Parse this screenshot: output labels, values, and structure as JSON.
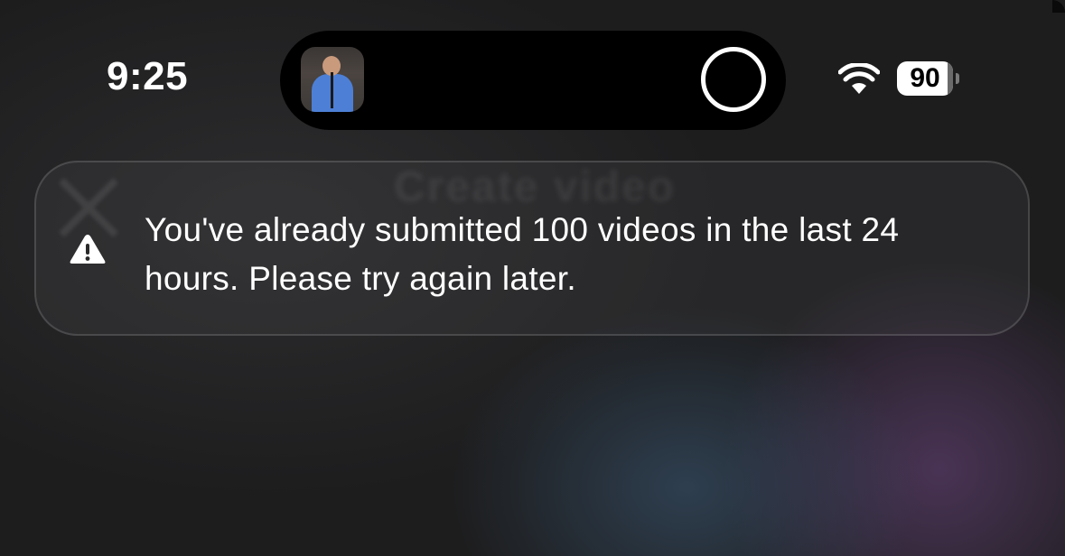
{
  "status_bar": {
    "time": "9:25",
    "battery_percent": "90",
    "battery_level": 0.9,
    "wifi_icon": "wifi-icon"
  },
  "dynamic_island": {
    "thumbnail_icon": "video-thumbnail",
    "activity_indicator_icon": "ring-indicator-icon"
  },
  "toast": {
    "icon": "warning-icon",
    "message": "You've already submitted 100 videos in the last 24 hours. Please try again later."
  },
  "background": {
    "blurred_text": "Create video"
  },
  "colors": {
    "text": "#ffffff",
    "background": "#1d1d1e",
    "island": "#000000"
  }
}
